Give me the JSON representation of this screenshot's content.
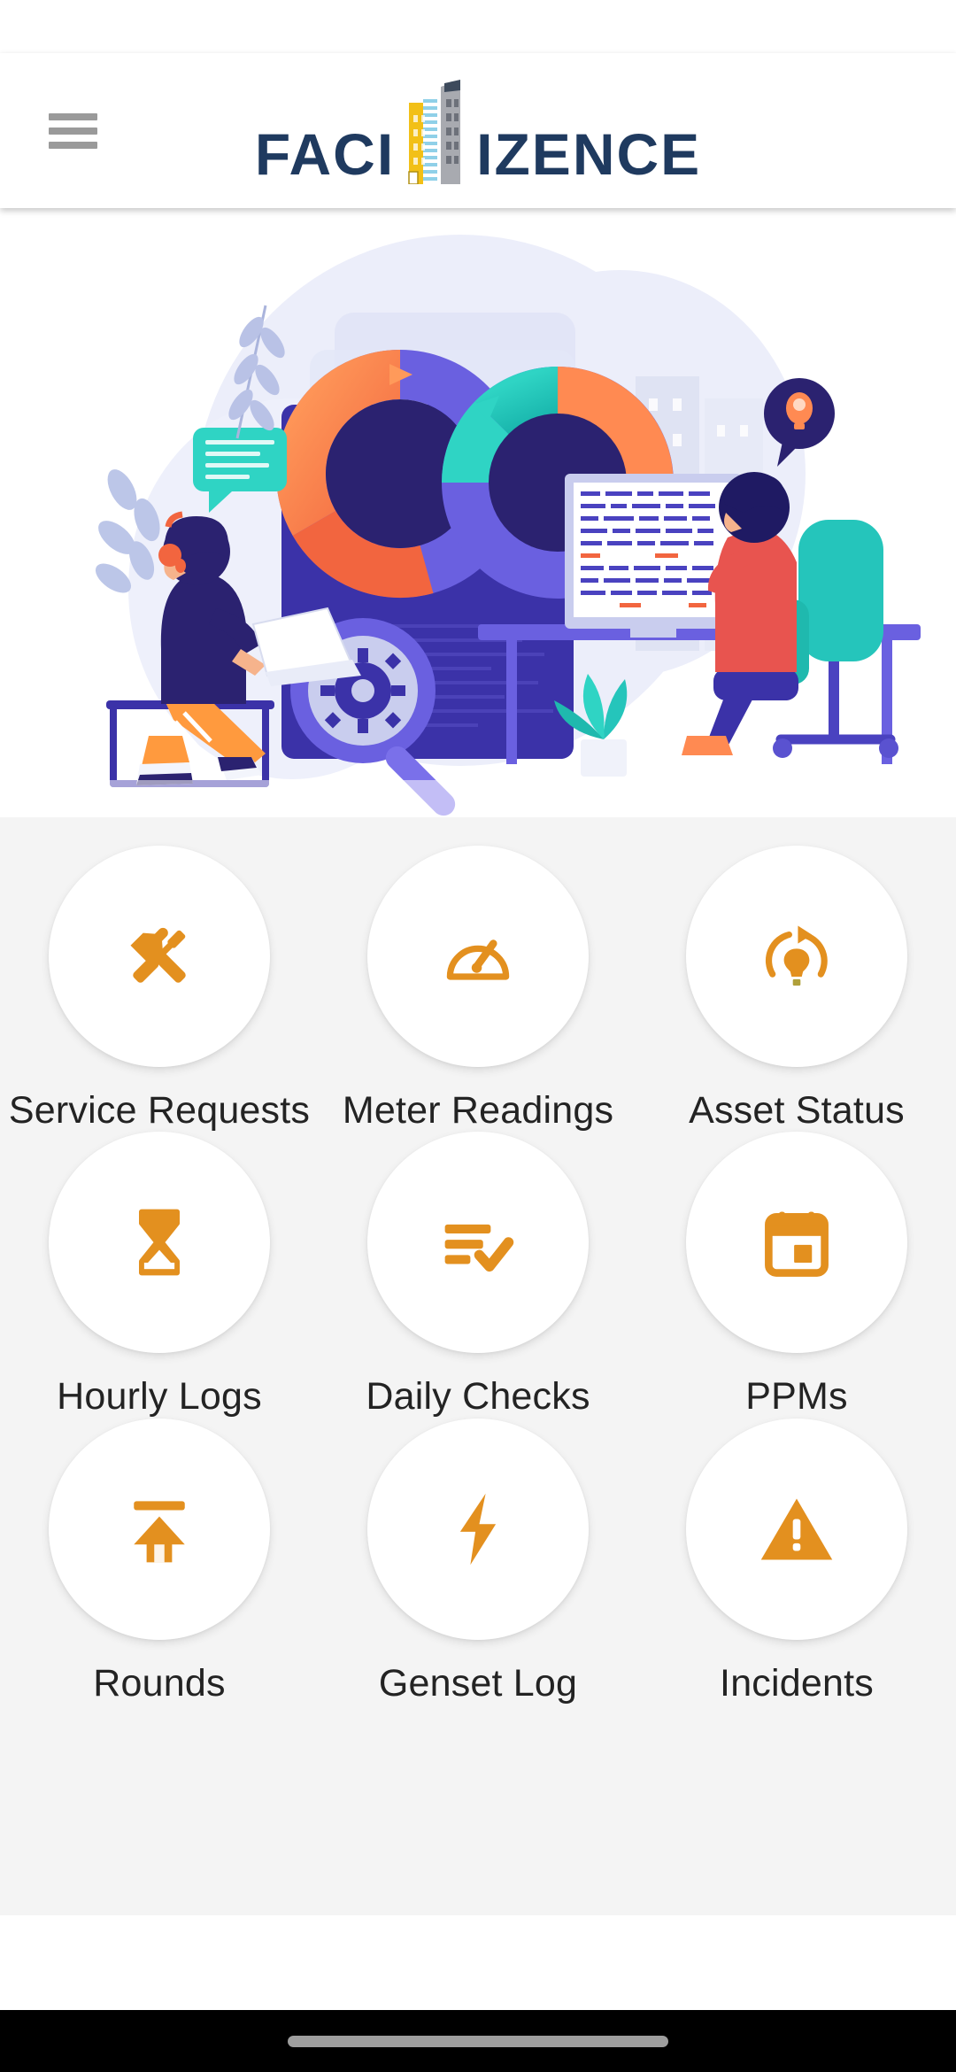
{
  "app": {
    "brand_name_part1": "FACI",
    "brand_name_part2": "IZENCE",
    "brand_color": "#1f3a5f",
    "accent_color": "#e3901f"
  },
  "header": {
    "menu_label": "Menu"
  },
  "hero": {
    "alt": "Two people working on facility management analytics with charts, laptop and desktop computer"
  },
  "grid": {
    "items": [
      {
        "label": "Service Requests",
        "icon": "tools-hammer-screwdriver-icon"
      },
      {
        "label": "Meter Readings",
        "icon": "speedometer-gauge-icon"
      },
      {
        "label": "Asset Status",
        "icon": "lightbulb-refresh-icon"
      },
      {
        "label": "Hourly Logs",
        "icon": "hourglass-icon"
      },
      {
        "label": "Daily Checks",
        "icon": "checklist-icon"
      },
      {
        "label": "PPMs",
        "icon": "calendar-icon"
      },
      {
        "label": "Rounds",
        "icon": "arrow-up-to-line-icon"
      },
      {
        "label": "Genset Log",
        "icon": "lightning-bolt-icon"
      },
      {
        "label": "Incidents",
        "icon": "warning-triangle-icon"
      }
    ]
  },
  "navbar": {
    "gesture_handle_label": "Home gesture bar"
  }
}
